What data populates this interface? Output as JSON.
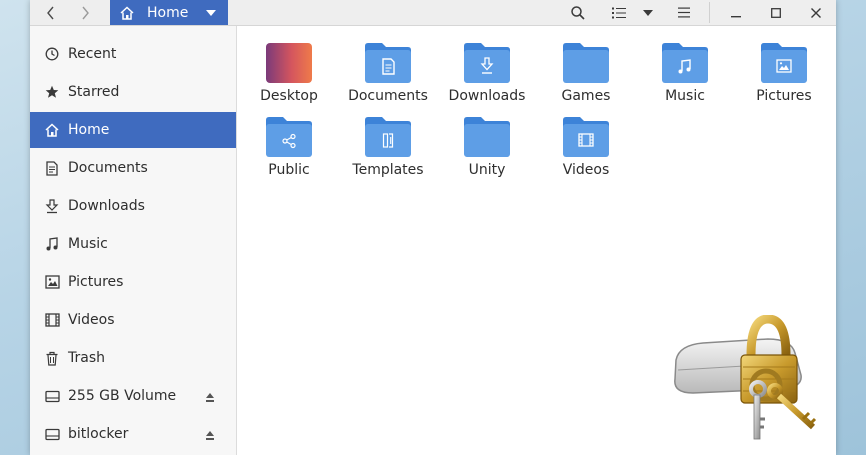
{
  "window": {
    "location": "Home"
  },
  "header": {
    "path_label": "Home"
  },
  "sidebar": {
    "items": [
      {
        "label": "Recent",
        "icon": "clock-icon"
      },
      {
        "label": "Starred",
        "icon": "star-icon"
      },
      {
        "label": "Home",
        "icon": "home-icon",
        "active": true
      },
      {
        "label": "Documents",
        "icon": "document-icon"
      },
      {
        "label": "Downloads",
        "icon": "download-icon"
      },
      {
        "label": "Music",
        "icon": "music-icon"
      },
      {
        "label": "Pictures",
        "icon": "picture-icon"
      },
      {
        "label": "Videos",
        "icon": "film-icon"
      },
      {
        "label": "Trash",
        "icon": "trash-icon"
      },
      {
        "label": "255 GB Volume",
        "icon": "drive-icon",
        "eject": true
      },
      {
        "label": "bitlocker",
        "icon": "drive-icon",
        "eject": true
      }
    ]
  },
  "files": [
    {
      "name": "Desktop",
      "icon": "desktop-folder-icon"
    },
    {
      "name": "Documents",
      "icon": "documents-folder-icon"
    },
    {
      "name": "Downloads",
      "icon": "downloads-folder-icon"
    },
    {
      "name": "Games",
      "icon": "folder-icon"
    },
    {
      "name": "Music",
      "icon": "music-folder-icon"
    },
    {
      "name": "Pictures",
      "icon": "pictures-folder-icon"
    },
    {
      "name": "Public",
      "icon": "public-folder-icon"
    },
    {
      "name": "Templates",
      "icon": "templates-folder-icon"
    },
    {
      "name": "Unity",
      "icon": "folder-icon"
    },
    {
      "name": "Videos",
      "icon": "videos-folder-icon"
    }
  ],
  "colors": {
    "accent": "#3f6bbf",
    "folder": "#5e9ee6",
    "folder_tab": "#3d83d8"
  }
}
